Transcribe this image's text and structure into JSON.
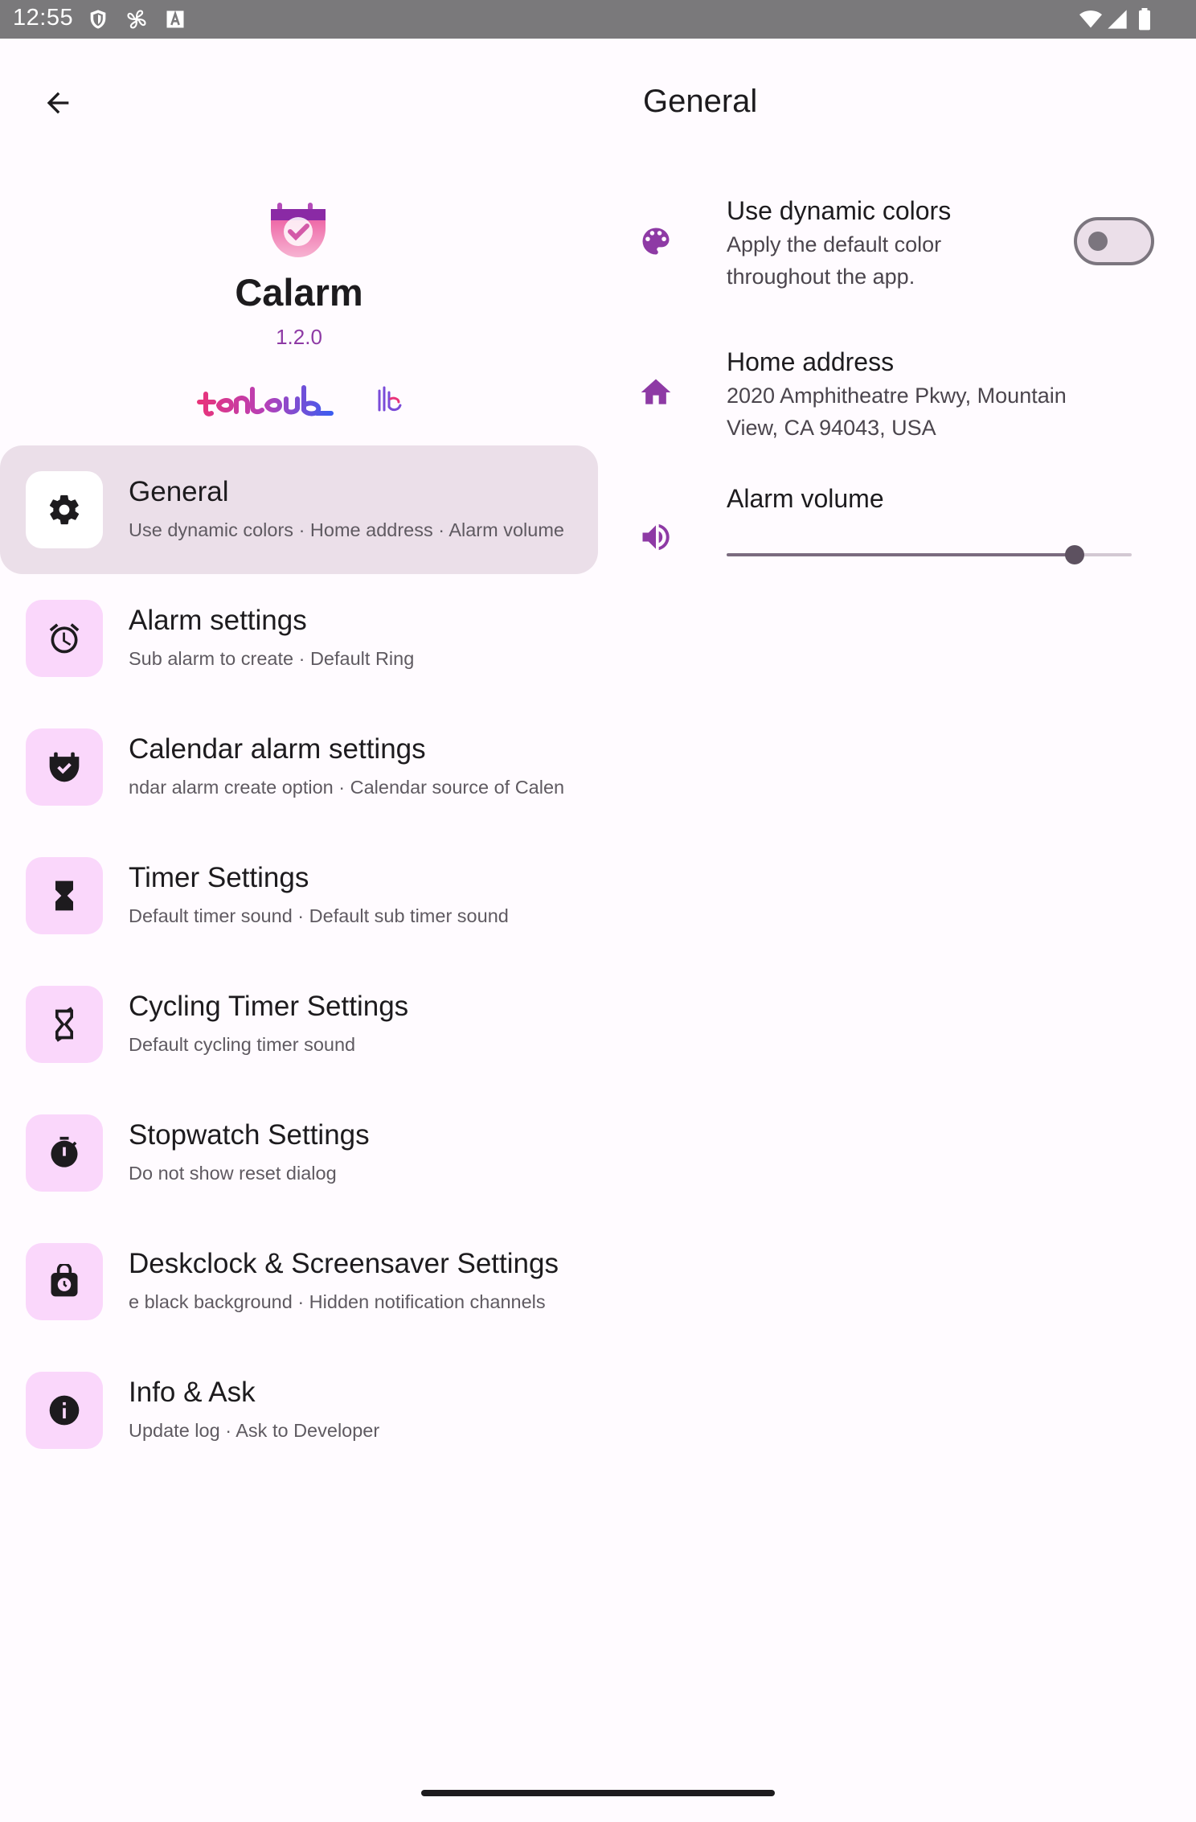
{
  "status_bar": {
    "time": "12:55",
    "left_icons": [
      "shield-icon",
      "fan-icon",
      "a-box-icon"
    ],
    "right_icons": [
      "wifi-icon",
      "signal-icon",
      "battery-icon"
    ]
  },
  "top_bar": {
    "back_icon": "arrow-left-icon",
    "detail_title": "General"
  },
  "app": {
    "name": "Calarm",
    "version": "1.2.0",
    "developer_logo_text": "tenlab"
  },
  "nav": {
    "items": [
      {
        "title": "General",
        "subtitle": "Use dynamic colors · Home address · Alarm volume",
        "icon": "gear-icon",
        "selected": true
      },
      {
        "title": "Alarm settings",
        "subtitle": "Sub alarm to create · Default Ring",
        "icon": "alarm-clock-icon"
      },
      {
        "title": "Calendar alarm settings",
        "subtitle": "ndar alarm create option · Calendar source of Calen",
        "icon": "calendar-check-icon"
      },
      {
        "title": "Timer Settings",
        "subtitle": "Default timer sound · Default sub timer sound",
        "icon": "hourglass-icon"
      },
      {
        "title": "Cycling Timer Settings",
        "subtitle": "Default cycling timer sound",
        "icon": "cycling-hourglass-icon"
      },
      {
        "title": "Stopwatch Settings",
        "subtitle": "Do not show reset dialog",
        "icon": "stopwatch-icon"
      },
      {
        "title": "Deskclock & Screensaver Settings",
        "subtitle": "e black background · Hidden notification channels",
        "icon": "desk-clock-icon"
      },
      {
        "title": "Info & Ask",
        "subtitle": "Update log · Ask to Developer",
        "icon": "info-icon"
      }
    ]
  },
  "general": {
    "dynamic_colors": {
      "title": "Use dynamic colors",
      "subtitle_line1": "Apply the default color",
      "subtitle_line2": "throughout the app.",
      "icon": "palette-icon",
      "enabled": false
    },
    "home_address": {
      "title": "Home address",
      "value_line1": "2020 Amphitheatre Pkwy, Mountain",
      "value_line2": "View, CA 94043, USA",
      "icon": "home-icon"
    },
    "alarm_volume": {
      "title": "Alarm volume",
      "icon": "volume-icon",
      "level": 0.86
    }
  },
  "colors": {
    "accent": "#8e3aa5",
    "selected_bg": "#ebdfe9",
    "icon_container": "#fad7fb",
    "background": "#fffbff"
  }
}
